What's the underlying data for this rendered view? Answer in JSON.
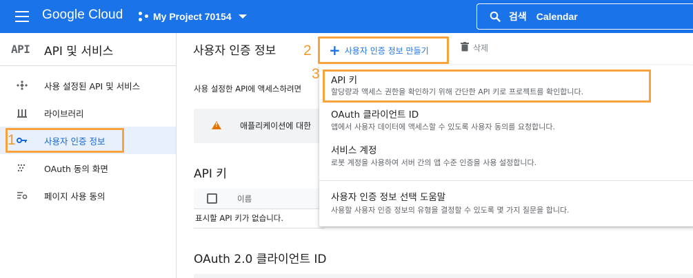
{
  "topbar": {
    "brand": "Google Cloud",
    "project_name": "My Project 70154",
    "search_label": "검색",
    "search_value": "Calendar",
    "colors": {
      "bar": "#1a73e8"
    }
  },
  "sidebar": {
    "logo": "API",
    "title": "API 및 서비스",
    "items": [
      {
        "label": "사용 설정된 API 및 서비스",
        "icon": "apps-diamond-icon"
      },
      {
        "label": "라이브러리",
        "icon": "library-icon"
      },
      {
        "label": "사용자 인증 정보",
        "icon": "key-icon",
        "active": true
      },
      {
        "label": "OAuth 동의 화면",
        "icon": "dots-grid-icon"
      },
      {
        "label": "페이지 사용 동의",
        "icon": "settings-list-icon"
      }
    ]
  },
  "main": {
    "page_title": "사용자 인증 정보",
    "create_button": "사용자 인증 정보 만들기",
    "delete_button": "삭제",
    "description": "사용 설정한 API에 액세스하려면",
    "warning": "애플리케이션에 대한",
    "api_keys_title": "API 키",
    "table_col_name": "이름",
    "api_keys_empty": "표시할 API 키가 없습니다.",
    "oauth_title": "OAuth 2.0 클라이언트 ID"
  },
  "menu": {
    "items": [
      {
        "title": "API 키",
        "subtitle": "할당량과 액세스 권한을 확인하기 위해 간단한 API 키로 프로젝트를 확인합니다."
      },
      {
        "title": "OAuth 클라이언트 ID",
        "subtitle": "앱에서 사용자 데이터에 액세스할 수 있도록 사용자 동의를 요청합니다."
      },
      {
        "title": "서비스 계정",
        "subtitle": "로봇 계정을 사용하여 서버 간의 앱 수준 인증을 사용 설정합니다."
      },
      {
        "title": "사용자 인증 정보 선택 도움말",
        "subtitle": "사용할 사용자 인증 정보의 유형을 결정할 수 있도록 몇 가지 질문을 합니다."
      }
    ]
  },
  "annotations": {
    "step1": "1",
    "step2": "2",
    "step3": "3",
    "color": "#f7a23b"
  }
}
